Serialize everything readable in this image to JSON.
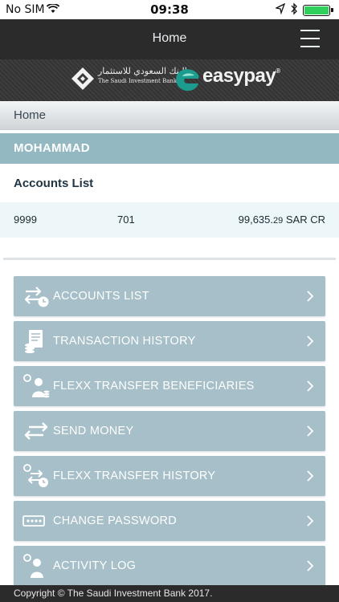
{
  "status_bar": {
    "carrier": "No SIM",
    "time": "09:38"
  },
  "nav": {
    "title": "Home"
  },
  "banner": {
    "bank_name_ar": "البنك السعودي للاستثمار",
    "bank_name_en": "The Saudi Investment Bank",
    "product_name": "easypay",
    "product_mark": "®"
  },
  "breadcrumb": {
    "current": "Home"
  },
  "user": {
    "name": "MOHAMMAD"
  },
  "accounts": {
    "title": "Accounts List",
    "rows": [
      {
        "account": "9999",
        "branch": "701",
        "balance_main": "99,635.",
        "balance_decimal": "29",
        "currency": "SAR CR"
      }
    ]
  },
  "menu": {
    "items": [
      {
        "label": "ACCOUNTS LIST",
        "icon": "transfer-clock-icon"
      },
      {
        "label": "TRANSACTION HISTORY",
        "icon": "document-coins-icon"
      },
      {
        "label": "FLEXX TRANSFER BENEFICIARIES",
        "icon": "beneficiaries-icon"
      },
      {
        "label": "SEND MONEY",
        "icon": "exchange-arrows-icon"
      },
      {
        "label": "FLEXX TRANSFER HISTORY",
        "icon": "transfer-history-icon"
      },
      {
        "label": "CHANGE PASSWORD",
        "icon": "password-icon"
      },
      {
        "label": "ACTIVITY LOG",
        "icon": "activity-user-icon"
      }
    ]
  },
  "footer": {
    "copyright": "Copyright © The Saudi Investment Bank 2017."
  },
  "colors": {
    "accent": "#94b8c2",
    "menu_item": "#a6bfc8",
    "nav": "#2b2b2b"
  }
}
